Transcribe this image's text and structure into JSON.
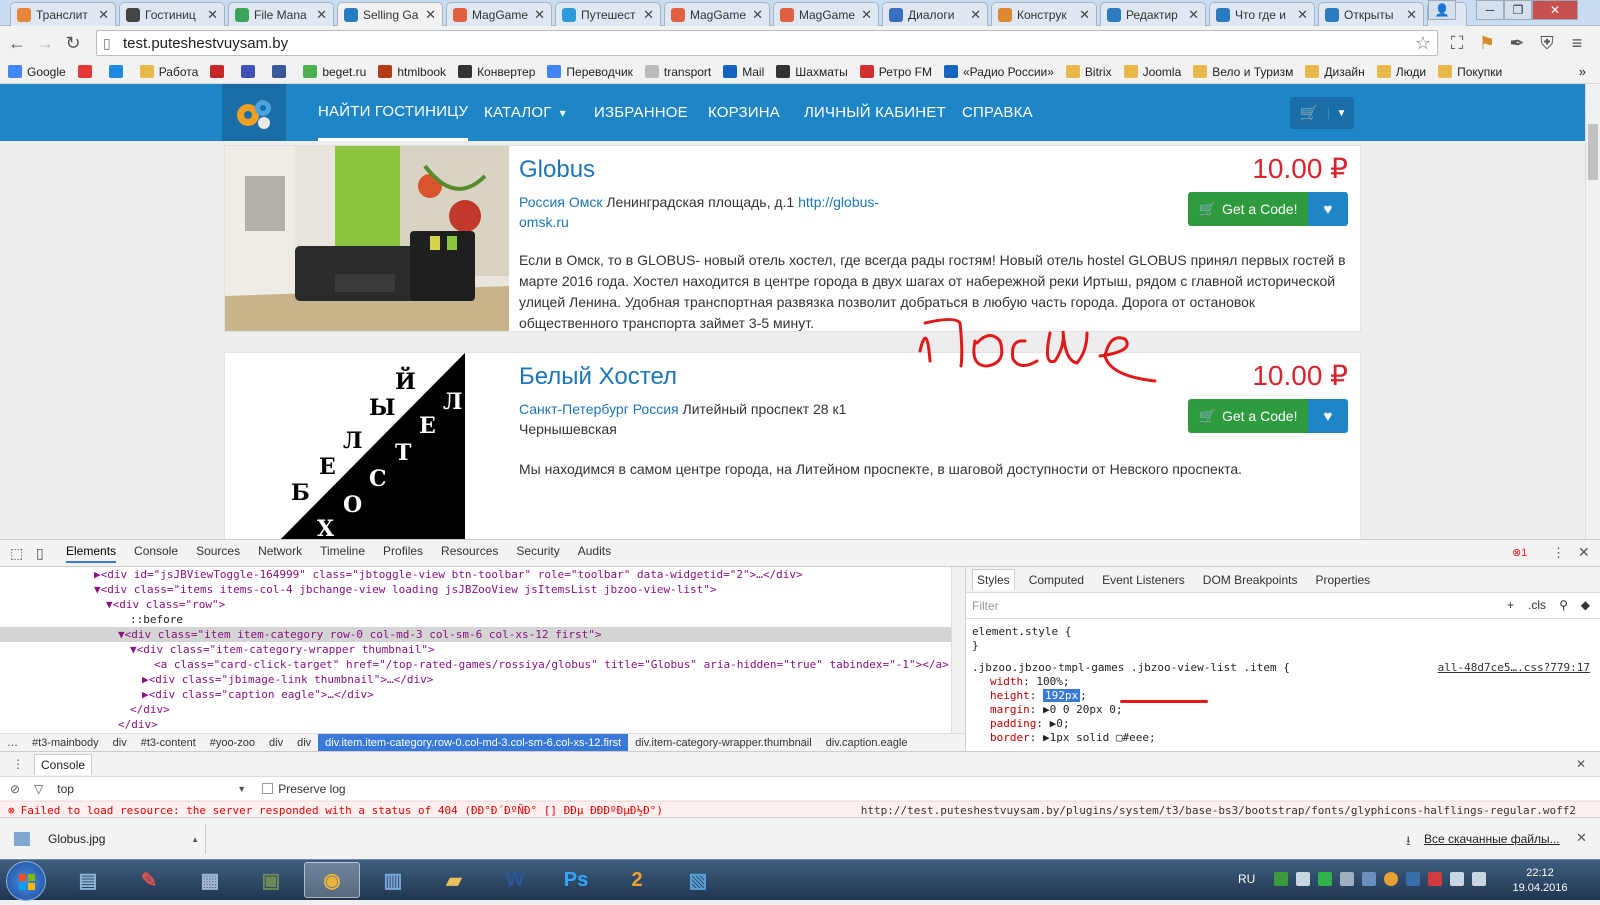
{
  "browser": {
    "tabs": [
      {
        "title": "Транслит",
        "color": "#e8873a"
      },
      {
        "title": "Гостиниц",
        "color": "#444444"
      },
      {
        "title": "File Mana",
        "color": "#3aa55a"
      },
      {
        "title": "Selling Ga",
        "color": "#2a7bc0",
        "active": true
      },
      {
        "title": "MagGame",
        "color": "#e06040"
      },
      {
        "title": "Путешест",
        "color": "#2a9bd8"
      },
      {
        "title": "MagGame",
        "color": "#e06040"
      },
      {
        "title": "MagGame",
        "color": "#e06040"
      },
      {
        "title": "Диалоги",
        "color": "#3a6fc0"
      },
      {
        "title": "Конструк",
        "color": "#e08830"
      },
      {
        "title": "Редактир",
        "color": "#2a7bc0"
      },
      {
        "title": "Что где и",
        "color": "#2a7bc0"
      },
      {
        "title": "Открыты",
        "color": "#2a7bc0"
      }
    ],
    "url": "test.puteshestvuysam.by",
    "bookmarks": [
      {
        "label": "Google",
        "color": "#4285f4"
      },
      {
        "label": "",
        "color": "#e53935"
      },
      {
        "label": "",
        "color": "#1e88e5"
      },
      {
        "label": "Работа",
        "folder": true
      },
      {
        "label": "",
        "color": "#c62828"
      },
      {
        "label": "",
        "color": "#3f51b5"
      },
      {
        "label": "",
        "color": "#3b5998"
      },
      {
        "label": "beget.ru",
        "color": "#4caf50"
      },
      {
        "label": "htmlbook",
        "color": "#b23c17"
      },
      {
        "label": "Конвертер",
        "color": "#333333"
      },
      {
        "label": "Переводчик",
        "color": "#4285f4"
      },
      {
        "label": "transport",
        "color": "#bbbbbb"
      },
      {
        "label": "Mail",
        "color": "#1565c0"
      },
      {
        "label": "Шахматы",
        "color": "#333333"
      },
      {
        "label": "Ретро FM",
        "color": "#d32f2f"
      },
      {
        "label": "«Радио России»",
        "color": "#1565c0"
      },
      {
        "label": "Bitrix",
        "folder": true
      },
      {
        "label": "Joomla",
        "folder": true
      },
      {
        "label": "Вело и Туризм",
        "folder": true
      },
      {
        "label": "Дизайн",
        "folder": true
      },
      {
        "label": "Люди",
        "folder": true
      },
      {
        "label": "Покупки",
        "folder": true
      }
    ]
  },
  "site": {
    "nav": [
      {
        "label": "НАЙТИ ГОСТИНИЦУ",
        "active": true
      },
      {
        "label": "КАТАЛОГ",
        "dropdown": true
      },
      {
        "label": "ИЗБРАННОЕ"
      },
      {
        "label": "КОРЗИНА"
      },
      {
        "label": "ЛИЧНЫЙ КАБИНЕТ"
      },
      {
        "label": "СПРАВКА"
      }
    ],
    "hotels": [
      {
        "title": "Globus",
        "country": "Россия",
        "city": "Омск",
        "address": "Ленинградская площадь, д.1",
        "link": "http://globus-omsk.ru",
        "price": "10.00 ₽",
        "button": "Get a Code!",
        "description": "Если в Омск, то в GLOBUS- новый отель хостел, где всегда рады гостям! Новый отель hostel GLOBUS принял первых гостей в марте 2016 года. Хостел находится в центре города в двух шагах от набережной реки Иртыш, рядом с главной исторической улицей Ленина. Удобная транспортная развязка позволит добраться в любую часть города. Дорога от остановок общественного транспорта займет 3-5 минут."
      },
      {
        "title": "Белый Хостел",
        "city": "Санкт-Петербург",
        "country": "Россия",
        "address": "Литейный проспект 28 к1",
        "metro": "Чернышевская",
        "price": "10.00 ₽",
        "button": "Get a Code!",
        "description": "Мы находимся в самом центре города, на Литейном проспекте, в шаговой доступности от Невского проспекта.",
        "logo_letters": [
          "Б",
          "Е",
          "Л",
          "Ы",
          "Й",
          "Х",
          "О",
          "С",
          "Т",
          "Е",
          "Л"
        ]
      }
    ],
    "annotation": "после"
  },
  "devtools": {
    "tabs": [
      "Elements",
      "Console",
      "Sources",
      "Network",
      "Timeline",
      "Profiles",
      "Resources",
      "Security",
      "Audits"
    ],
    "error_count": "1",
    "dom_lines": [
      {
        "indent": 7,
        "text": "▶<div id=\"jsJBViewToggle-164999\" class=\"jbtoggle-view btn-toolbar\" role=\"toolbar\" data-widgetid=\"2\">…</div>"
      },
      {
        "indent": 7,
        "text": "▼<div class=\"items items-col-4 jbchange-view loading jsJBZooView jsItemsList jbzoo-view-list\">"
      },
      {
        "indent": 8,
        "text": "▼<div class=\"row\">"
      },
      {
        "indent": 10,
        "text": "::before"
      },
      {
        "indent": 9,
        "text": "▼<div class=\"item item-category row-0 col-md-3 col-sm-6 col-xs-12 first\">",
        "selected": true
      },
      {
        "indent": 10,
        "text": "▼<div class=\"item-category-wrapper thumbnail\">"
      },
      {
        "indent": 12,
        "text": "<a class=\"card-click-target\" href=\"/top-rated-games/rossiya/globus\" title=\"Globus\" aria-hidden=\"true\" tabindex=\"-1\"></a>"
      },
      {
        "indent": 11,
        "text": "▶<div class=\"jbimage-link thumbnail\">…</div>"
      },
      {
        "indent": 11,
        "text": "▶<div class=\"caption eagle\">…</div>"
      },
      {
        "indent": 10,
        "text": "</div>"
      },
      {
        "indent": 9,
        "text": "</div>"
      }
    ],
    "breadcrumb": [
      "…",
      "#t3-mainbody",
      "div",
      "#t3-content",
      "#yoo-zoo",
      "div",
      "div",
      "div.item.item-category.row-0.col-md-3.col-sm-6.col-xs-12.first",
      "div.item-category-wrapper.thumbnail",
      "div.caption.eagle"
    ],
    "breadcrumb_selected": 7,
    "style_tabs": [
      "Styles",
      "Computed",
      "Event Listeners",
      "DOM Breakpoints",
      "Properties"
    ],
    "filter_placeholder": "Filter",
    "cls_label": ".cls",
    "element_style": "element.style {",
    "rule_selector": ".jbzoo.jbzoo-tmpl-games .jbzoo-view-list .item {",
    "rule_source": "all-48d7ce5….css?779:17",
    "rule_props": [
      {
        "name": "width",
        "value": "100%;"
      },
      {
        "name": "height",
        "value": "192px",
        "highlight": true
      },
      {
        "name": "margin",
        "value": "▶0 0 20px 0;"
      },
      {
        "name": "padding",
        "value": "▶0;"
      },
      {
        "name": "border",
        "value": "▶1px solid ▢#eee;"
      }
    ],
    "console_label": "Console",
    "context": "top",
    "preserve_log": "Preserve log",
    "error_text": "Failed to load resource: the server responded with a status of 404 (ÐÐ°Ð´ÐºÑÐ° [] ÐÐµ ÐÐÐºÐµÐ½Ð°)",
    "error_url": "http://test.puteshestvuysam.by/plugins/system/t3/base-bs3/bootstrap/fonts/glyphicons-halflings-regular.woff2"
  },
  "downloads": {
    "file": "Globus.jpg",
    "all": "Все скачанные файлы..."
  },
  "taskbar": {
    "lang": "RU",
    "time": "22:12",
    "date": "19.04.2016",
    "apps": [
      {
        "name": "explorer-app",
        "glyph": "▤",
        "color": "#8fb4d9"
      },
      {
        "name": "paint-app",
        "glyph": "✎",
        "color": "#d9544f"
      },
      {
        "name": "calculator-app",
        "glyph": "▦",
        "color": "#9fb8cf"
      },
      {
        "name": "terminal-app",
        "glyph": "▣",
        "color": "#6a8a5a"
      },
      {
        "name": "chrome-app",
        "glyph": "◉",
        "color": "#e8b53a",
        "active": true
      },
      {
        "name": "network-app",
        "glyph": "▥",
        "color": "#7aa7d6"
      },
      {
        "name": "folder-app",
        "glyph": "▰",
        "color": "#e8c15a"
      },
      {
        "name": "word-app",
        "glyph": "W",
        "color": "#2b579a"
      },
      {
        "name": "photoshop-app",
        "glyph": "Ps",
        "color": "#31a8ff"
      },
      {
        "name": "game-app",
        "glyph": "2",
        "color": "#f0a030"
      },
      {
        "name": "image-viewer-app",
        "glyph": "▧",
        "color": "#5aa0d8"
      }
    ]
  }
}
